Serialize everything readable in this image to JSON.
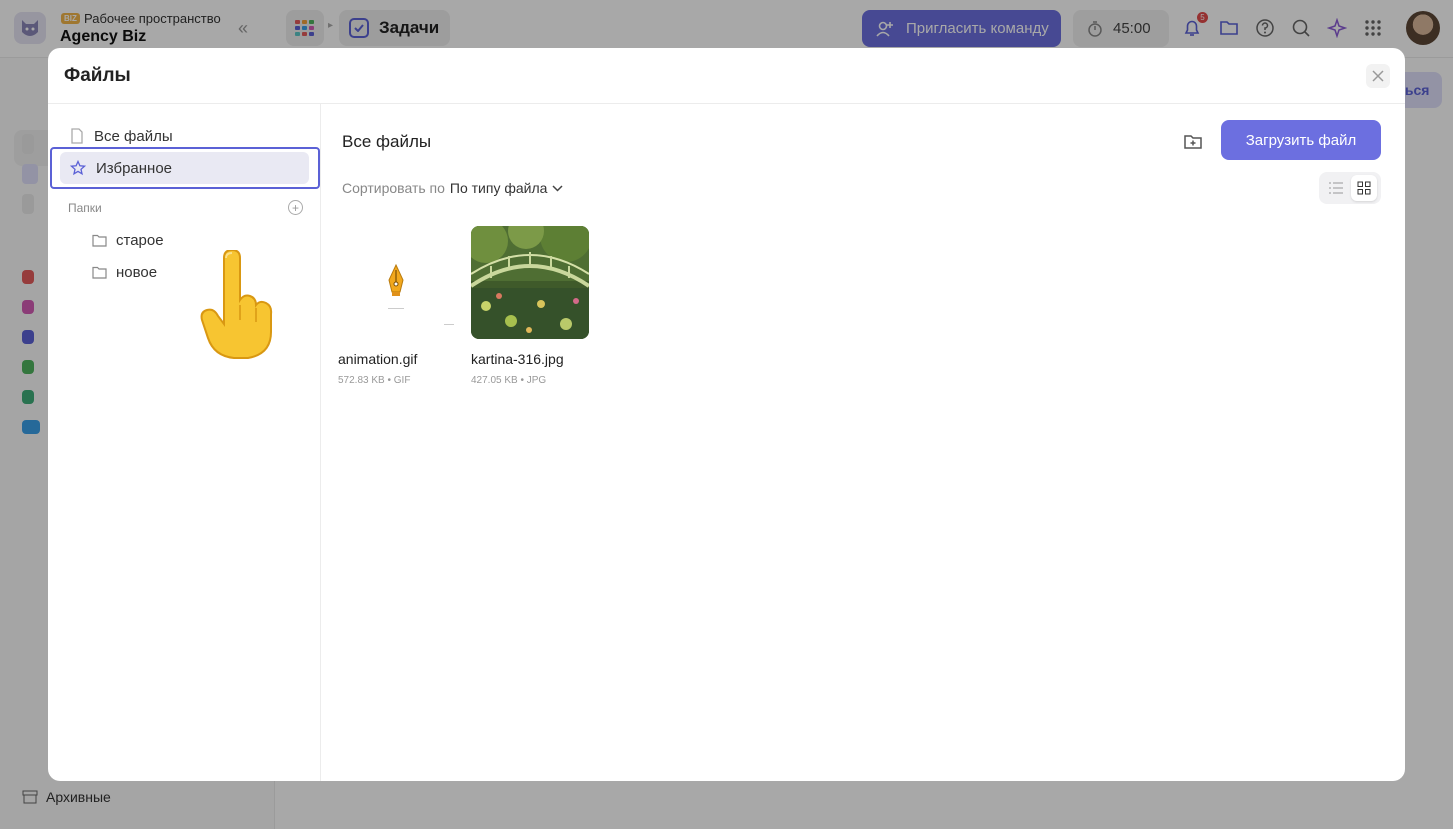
{
  "app": {
    "workspace_label": "Рабочее пространство",
    "workspace_badge": "BIZ",
    "workspace_name": "Agency Biz",
    "breadcrumb_current": "Задачи",
    "invite_button": "Пригласить команду",
    "timer": "45:00",
    "notification_count": "5",
    "right_button_fragment": "ться",
    "sidebar_archive": "Архивные"
  },
  "modal": {
    "title": "Файлы",
    "sidebar": {
      "items": [
        {
          "label": "Все файлы",
          "icon": "file-icon",
          "selected": false
        },
        {
          "label": "Избранное",
          "icon": "star-icon",
          "selected": true
        }
      ],
      "folders_label": "Папки",
      "folders": [
        {
          "label": "старое",
          "icon": "folder-icon"
        },
        {
          "label": "новое",
          "icon": "folder-icon"
        }
      ]
    },
    "main": {
      "title": "Все файлы",
      "upload_button": "Загрузить файл",
      "sort_label": "Сортировать по",
      "sort_value": "По типу файла",
      "view_mode": "grid",
      "files": [
        {
          "name": "animation.gif",
          "meta": "572.83 KB • GIF",
          "thumb": "pen-nib-icon"
        },
        {
          "name": "kartina-316.jpg",
          "meta": "427.05 KB • JPG",
          "thumb": "painting-image"
        }
      ]
    }
  },
  "colors": {
    "accent": "#6c6fe0",
    "focus_ring": "#5b61d6",
    "selected_bg": "#e9e9f3",
    "overlay": "rgba(0,0,0,0.34)"
  },
  "cursor": {
    "type": "pointing-hand",
    "glyph": "👆"
  }
}
